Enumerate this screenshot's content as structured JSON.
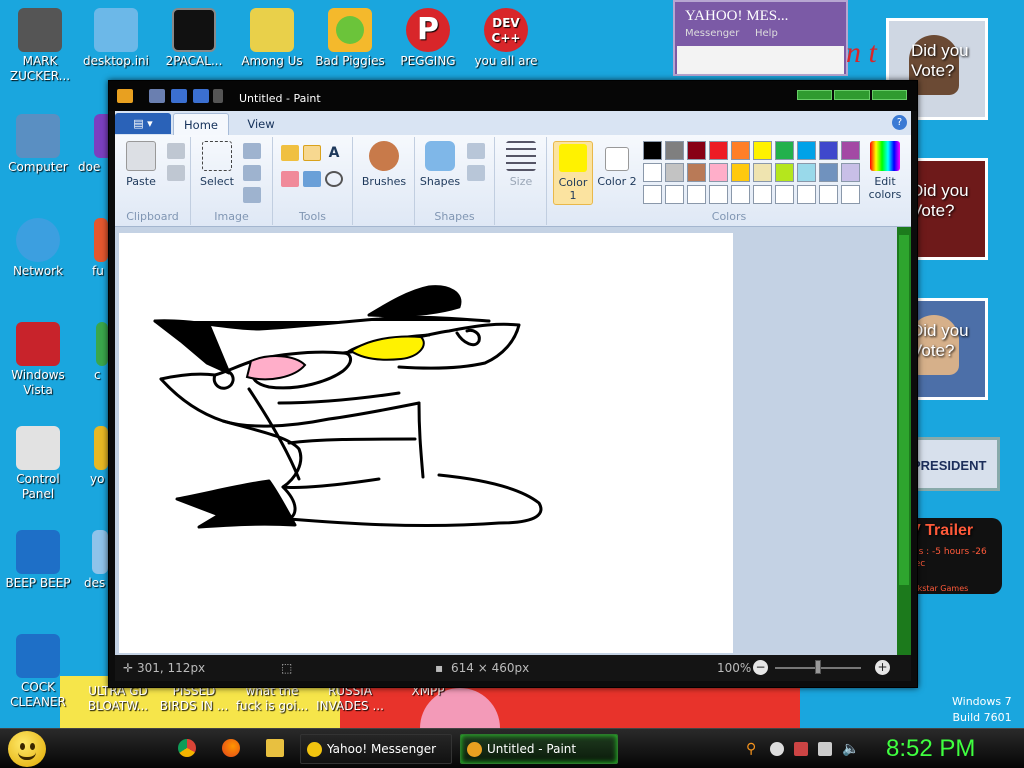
{
  "desktop": {
    "icons_top": [
      {
        "label": "MARK ZUCKER...",
        "color": "#444444"
      },
      {
        "label": "desktop.ini",
        "color": "#5fb2e6"
      },
      {
        "label": "2PACAL...",
        "color": "#111111"
      },
      {
        "label": "Among Us",
        "color": "#7cc6e8"
      },
      {
        "label": "Bad Piggies",
        "color": "#6bc43a"
      },
      {
        "label": "PEGGING",
        "color": "#d8262a"
      },
      {
        "label": "you all are",
        "color": "#d8262a"
      }
    ],
    "icons_left": [
      {
        "label": "Computer",
        "color": "#5a8fc2"
      },
      {
        "label": "Network",
        "color": "#3c9fe0"
      },
      {
        "label": "Windows Vista",
        "color": "#c8232b"
      },
      {
        "label": "Control Panel",
        "color": "#e2e2e2"
      },
      {
        "label": "BEEP BEEP",
        "color": "#1e6fc7"
      },
      {
        "label": "COCK CLEANER",
        "color": "#1e6fc7"
      }
    ],
    "icons_peek": [
      {
        "label": "doe",
        "color": "#7b3fc0"
      },
      {
        "label": "fu",
        "color": "#e5572e"
      },
      {
        "label": "c",
        "color": "#3aa64b"
      },
      {
        "label": "yo",
        "color": "#e8b824"
      },
      {
        "label": "des",
        "color": "#8fc3ea"
      }
    ],
    "icons_bottom": [
      {
        "label": "ULTRA GD BLOATW..."
      },
      {
        "label": "PISSED BIRDS IN ..."
      },
      {
        "label": "what the fuck is goi..."
      },
      {
        "label": "RUSSIA INVADES ..."
      },
      {
        "label": "XMPP"
      }
    ],
    "dev_icon_text": "DEV C++",
    "peg_icon_text": "P",
    "windows_watermark": {
      "line1": "Windows 7",
      "line2": "Build 7601"
    }
  },
  "background_windows": {
    "yahoo": {
      "title": "YAHOO! MES...",
      "menu1": "Messenger",
      "menu2": "Help"
    },
    "ads": [
      {
        "text": "Did you Vote?"
      },
      {
        "text": "Did you Vote?"
      },
      {
        "text": "Did you Vote?"
      },
      {
        "text": "R PRESIDENT"
      },
      {
        "text": "V Trailer",
        "sub": "...s : -5 hours\n-26 sec",
        "brand": "...kstar Games"
      }
    ],
    "partial_red_text": "n t"
  },
  "paint": {
    "title": "Untitled - Paint",
    "tabs": {
      "home": "Home",
      "view": "View"
    },
    "groups": {
      "clipboard": {
        "label": "Clipboard",
        "paste": "Paste"
      },
      "image": {
        "label": "Image",
        "select": "Select"
      },
      "tools": {
        "label": "Tools"
      },
      "brushes": {
        "label": "Brushes"
      },
      "shapes": {
        "label": "Shapes",
        "button": "Shapes"
      },
      "size": {
        "label": "Size"
      },
      "colors": {
        "label": "Colors",
        "color1": "Color 1",
        "color2": "Color 2",
        "edit": "Edit colors"
      }
    },
    "color1": "#fff200",
    "color2": "#ffffff",
    "palette": [
      "#000000",
      "#7f7f7f",
      "#880015",
      "#ed1c24",
      "#ff7f27",
      "#fff200",
      "#22b14c",
      "#00a2e8",
      "#3f48cc",
      "#a349a4",
      "#ffffff",
      "#c3c3c3",
      "#b97a57",
      "#ffaec9",
      "#ffc90e",
      "#efe4b0",
      "#b5e61d",
      "#99d9ea",
      "#7092be",
      "#c8bfe7",
      "#ffffff",
      "#ffffff",
      "#ffffff",
      "#ffffff",
      "#ffffff",
      "#ffffff",
      "#ffffff",
      "#ffffff",
      "#ffffff",
      "#ffffff"
    ],
    "status": {
      "coords": "301, 112px",
      "size": "614 × 460px",
      "zoom": "100%"
    }
  },
  "taskbar": {
    "tasks": [
      {
        "label": "Yahoo! Messenger",
        "color": "#f2c40f"
      },
      {
        "label": "Untitled - Paint",
        "color": "#e8a020"
      }
    ],
    "clock": "8:52 PM"
  }
}
